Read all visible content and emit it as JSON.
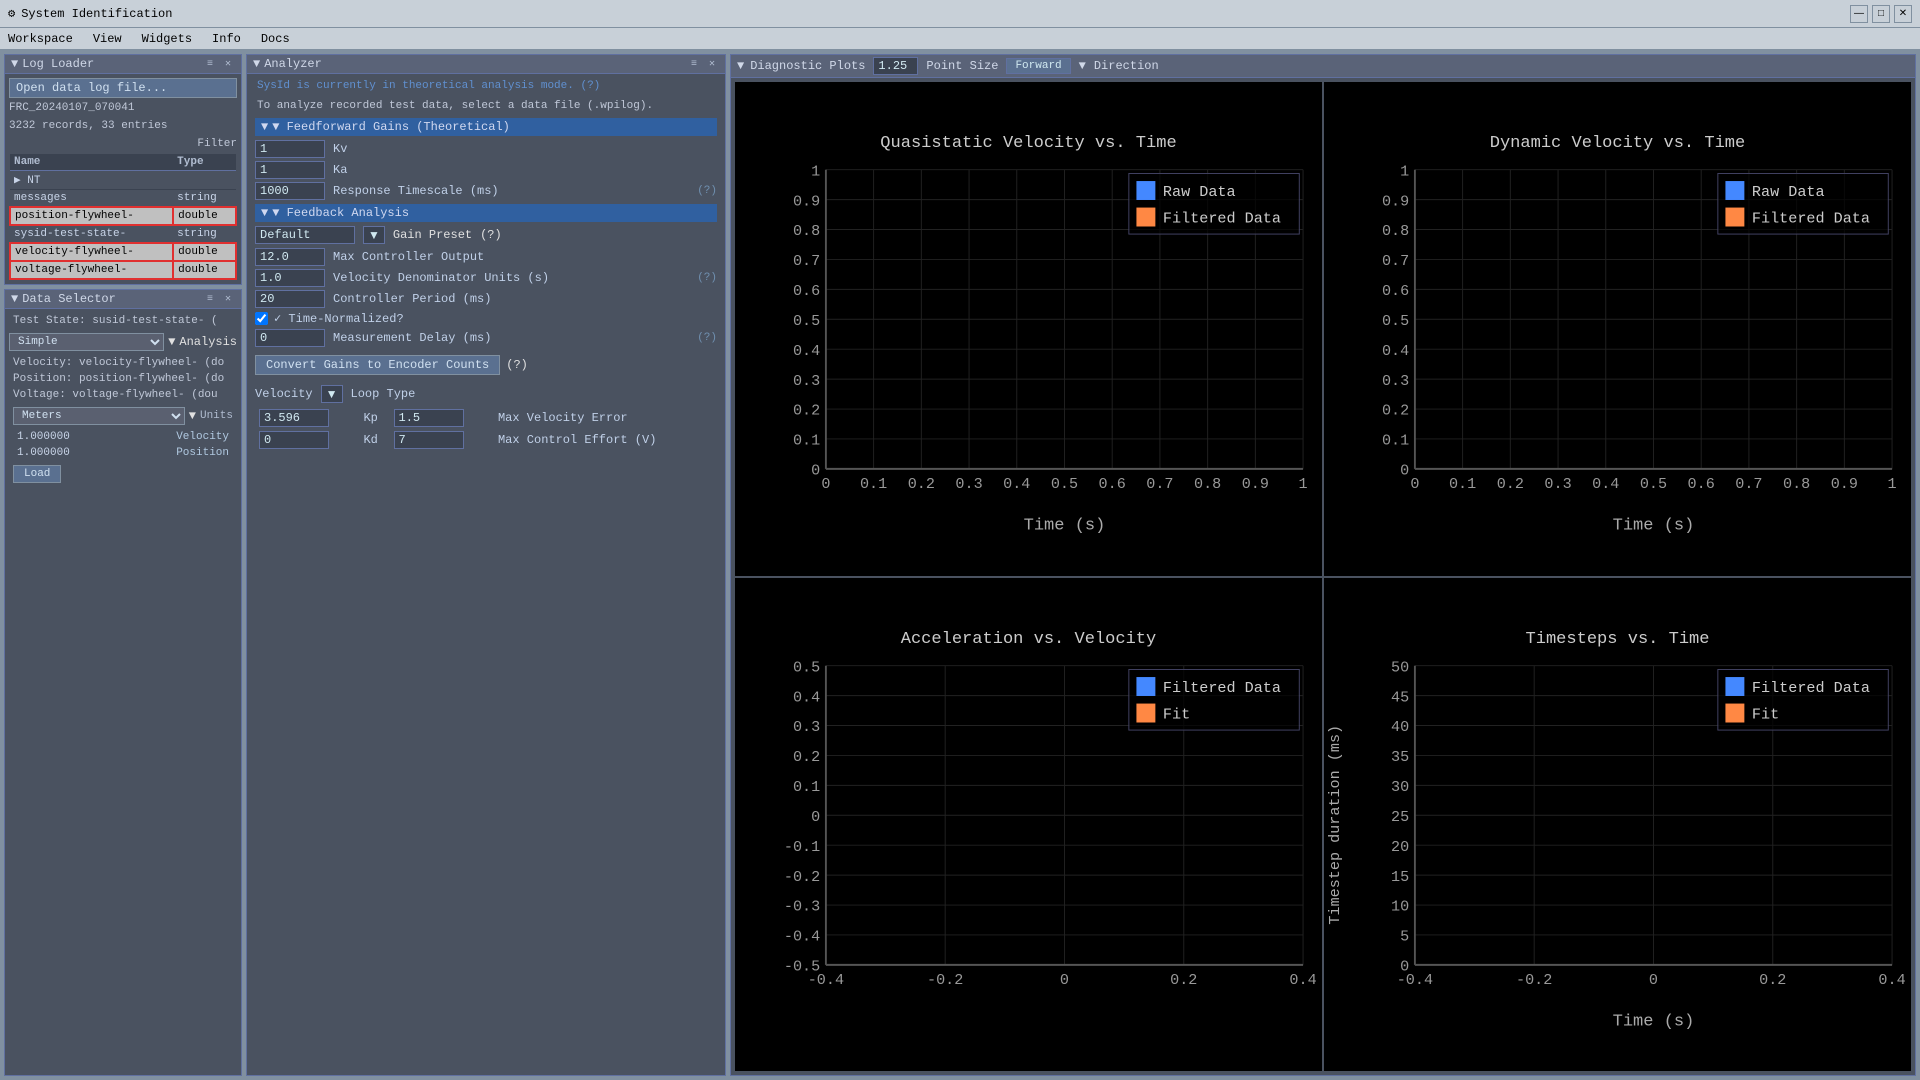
{
  "titlebar": {
    "icon": "⚙",
    "title": "System Identification",
    "minimize": "—",
    "maximize": "□",
    "close": "✕"
  },
  "menubar": {
    "items": [
      "Workspace",
      "View",
      "Widgets",
      "Info",
      "Docs"
    ]
  },
  "logLoader": {
    "title": "Log Loader",
    "open_btn": "Open data log file...",
    "file": "FRC_20240107_070041",
    "records": "3232 records, 33 entries",
    "filter_label": "Filter",
    "columns": [
      "Name",
      "Type"
    ],
    "rows": [
      {
        "name": "▶ NT",
        "type": "",
        "style": "nt"
      },
      {
        "name": "messages",
        "type": "string",
        "style": "normal"
      },
      {
        "name": "position-flywheel-",
        "type": "double",
        "style": "highlighted"
      },
      {
        "name": "sysid-test-state-",
        "type": "string",
        "style": "normal"
      },
      {
        "name": "velocity-flywheel-",
        "type": "double",
        "style": "highlighted"
      },
      {
        "name": "voltage-flywheel-",
        "type": "double",
        "style": "highlighted"
      }
    ]
  },
  "dataSelector": {
    "title": "Data Selector",
    "test_state": "Test State: susid-test-state- (",
    "analysis_type": "Simple",
    "analysis_label": "Analysis",
    "fields": [
      "Velocity: velocity-flywheel- (do",
      "Position: position-flywheel- (do",
      "Voltage: voltage-flywheel- (dou"
    ],
    "units_label": "Meters",
    "units_dropdown": "Units",
    "entries": [
      {
        "value": "1.000000",
        "label": "Velocity"
      },
      {
        "value": "1.000000",
        "label": "Position"
      }
    ],
    "load_btn": "Load"
  },
  "analyzer": {
    "title": "Analyzer",
    "sysid_info1": "SysId is currently in theoretical analysis mode.",
    "sysid_info2": "To analyze recorded test data, select a data file (.wpilog).",
    "help_q": "(?)",
    "feedforward_header": "▼ Feedforward Gains (Theoretical)",
    "ff_gains": [
      {
        "value": "1",
        "label": "Kv"
      },
      {
        "value": "1",
        "label": "Ka"
      },
      {
        "value": "1000",
        "label": "Response Timescale (ms)",
        "help": "(?)"
      }
    ],
    "feedback_header": "▼ Feedback Analysis",
    "gain_preset_label": "Default",
    "gain_preset_btn": "▼",
    "gain_preset_title": "Gain Preset",
    "gain_preset_help": "(?)",
    "feedback_rows": [
      {
        "value": "12.0",
        "label": "Max Controller Output"
      },
      {
        "value": "1.0",
        "label": "Velocity Denominator Units (s)",
        "help": "(?)"
      },
      {
        "value": "20",
        "label": "Controller Period (ms)"
      }
    ],
    "time_normalized_label": "✓ Time-Normalized?",
    "measurement_delay": {
      "value": "0",
      "label": "Measurement Delay (ms)",
      "help": "(?)"
    },
    "convert_btn": "Convert Gains to Encoder Counts",
    "convert_help": "(?)",
    "loop_type_label": "Velocity",
    "loop_type_dropdown": "▼",
    "loop_type_title": "Loop Type",
    "kp_row": {
      "value": "3.596",
      "label": "Kp",
      "max_label": "Max Velocity Error",
      "max_value": "1.5"
    },
    "kd_row": {
      "value": "0",
      "label": "Kd",
      "max_label": "Max Control Effort (V)",
      "max_value": "7"
    }
  },
  "diagnosticPlots": {
    "title": "Diagnostic Plots",
    "point_size": "1.25",
    "point_size_label": "Point Size",
    "forward_btn": "Forward",
    "direction_label": "Direction",
    "plots": [
      {
        "title": "Quasistatic Velocity vs. Time",
        "legend": [
          {
            "color": "#4488ff",
            "label": "Raw Data"
          },
          {
            "color": "#ff8844",
            "label": "Filtered Data"
          }
        ],
        "xaxis": "Time (s)",
        "yaxis": "",
        "xrange": [
          0,
          1
        ],
        "yrange": [
          0,
          1
        ],
        "yticks": [
          0,
          0.1,
          0.2,
          0.3,
          0.4,
          0.5,
          0.6,
          0.7,
          0.8,
          0.9,
          1
        ],
        "xticks": [
          0,
          0.1,
          0.2,
          0.3,
          0.4,
          0.5,
          0.6,
          0.7,
          0.8,
          0.9,
          1
        ]
      },
      {
        "title": "Dynamic Velocity vs. Time",
        "legend": [
          {
            "color": "#4488ff",
            "label": "Raw Data"
          },
          {
            "color": "#ff8844",
            "label": "Filtered Data"
          }
        ],
        "xaxis": "Time (s)",
        "yaxis": "",
        "xrange": [
          0,
          1
        ],
        "yrange": [
          0,
          1
        ],
        "yticks": [
          0,
          0.1,
          0.2,
          0.3,
          0.4,
          0.5,
          0.6,
          0.7,
          0.8,
          0.9,
          1
        ],
        "xticks": [
          0,
          0.1,
          0.2,
          0.3,
          0.4,
          0.5,
          0.6,
          0.7,
          0.8,
          0.9,
          1
        ]
      },
      {
        "title": "Acceleration vs. Velocity",
        "legend": [
          {
            "color": "#4488ff",
            "label": "Filtered Data"
          },
          {
            "color": "#ff8844",
            "label": "Fit"
          }
        ],
        "xaxis": "",
        "yaxis": "",
        "xrange": [
          -0.4,
          0.4
        ],
        "yrange": [
          -0.5,
          0.5
        ],
        "yticks": [
          -0.5,
          -0.4,
          -0.3,
          -0.2,
          -0.1,
          0,
          0.1,
          0.2,
          0.3,
          0.4,
          0.5
        ],
        "xticks": [
          -0.4,
          -0.2,
          0,
          0.2,
          0.4
        ]
      },
      {
        "title": "Timesteps vs. Time",
        "legend": [
          {
            "color": "#4488ff",
            "label": "Filtered Data"
          },
          {
            "color": "#ff8844",
            "label": "Fit"
          }
        ],
        "xaxis": "Time (s)",
        "yaxis": "Timestep duration (ms)",
        "xrange": [
          -0.4,
          0.4
        ],
        "yrange": [
          0,
          50
        ],
        "yticks": [
          0,
          5,
          10,
          15,
          20,
          25,
          30,
          35,
          40,
          45,
          50
        ],
        "xticks": [
          -0.4,
          -0.2,
          0,
          0.2,
          0.4
        ]
      }
    ]
  }
}
